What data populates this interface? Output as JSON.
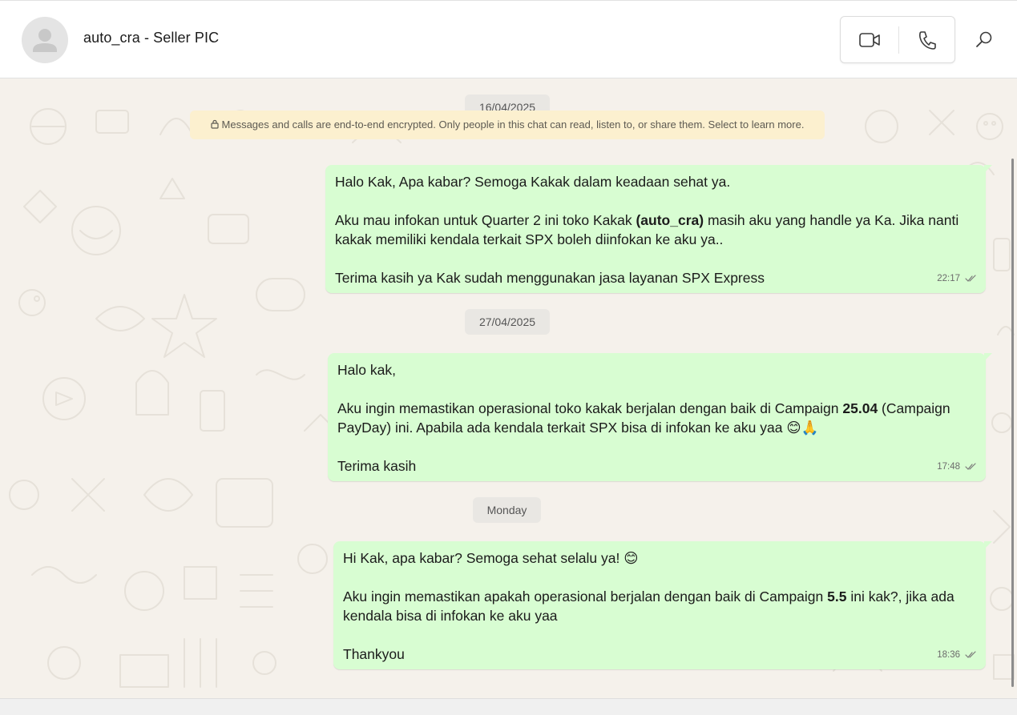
{
  "header": {
    "contact_name": "auto_cra - Seller PIC",
    "video_call_icon": "video-camera-icon",
    "voice_call_icon": "phone-icon",
    "search_icon": "search-icon"
  },
  "encryption_notice": {
    "icon": "lock-icon",
    "text": "Messages and calls are end-to-end encrypted. Only people in this chat can read, listen to, or share them. Select to learn more."
  },
  "date_separators": [
    "16/04/2025",
    "27/04/2025",
    "Monday"
  ],
  "messages": [
    {
      "line1": "Halo Kak, Apa kabar? Semoga Kakak dalam keadaan sehat ya.",
      "line2a": "Aku mau infokan untuk Quarter 2 ini toko Kakak ",
      "line2_bold": "(auto_cra)",
      "line2b": " masih aku yang handle ya Ka. Jika nanti kakak memiliki kendala terkait SPX boleh diinfokan ke aku ya..",
      "line3": "Terima kasih ya Kak sudah menggunakan jasa layanan SPX Express",
      "time": "22:17",
      "status_icon": "double-check-icon"
    },
    {
      "line1": "Halo kak,",
      "line2a": "Aku ingin memastikan operasional toko kakak berjalan dengan baik di Campaign ",
      "line2_bold": "25.04",
      "line2b": " (Campaign PayDay) ini. Apabila ada kendala terkait SPX bisa di infokan ke aku yaa 😊🙏",
      "line3": "Terima kasih",
      "time": "17:48",
      "status_icon": "double-check-icon"
    },
    {
      "line1": "Hi Kak, apa kabar? Semoga sehat selalu ya! 😊",
      "line2a": "Aku ingin memastikan apakah operasional berjalan dengan baik di Campaign ",
      "line2_bold": "5.5",
      "line2b": " ini kak?, jika ada kendala bisa di infokan ke aku yaa",
      "line3": "Thankyou",
      "time": "18:36",
      "status_icon": "double-check-icon"
    }
  ],
  "colors": {
    "outgoing_bubble": "#d8fdd2",
    "chat_background": "#f5f1eb",
    "encryption_banner": "#fcf0cf"
  }
}
